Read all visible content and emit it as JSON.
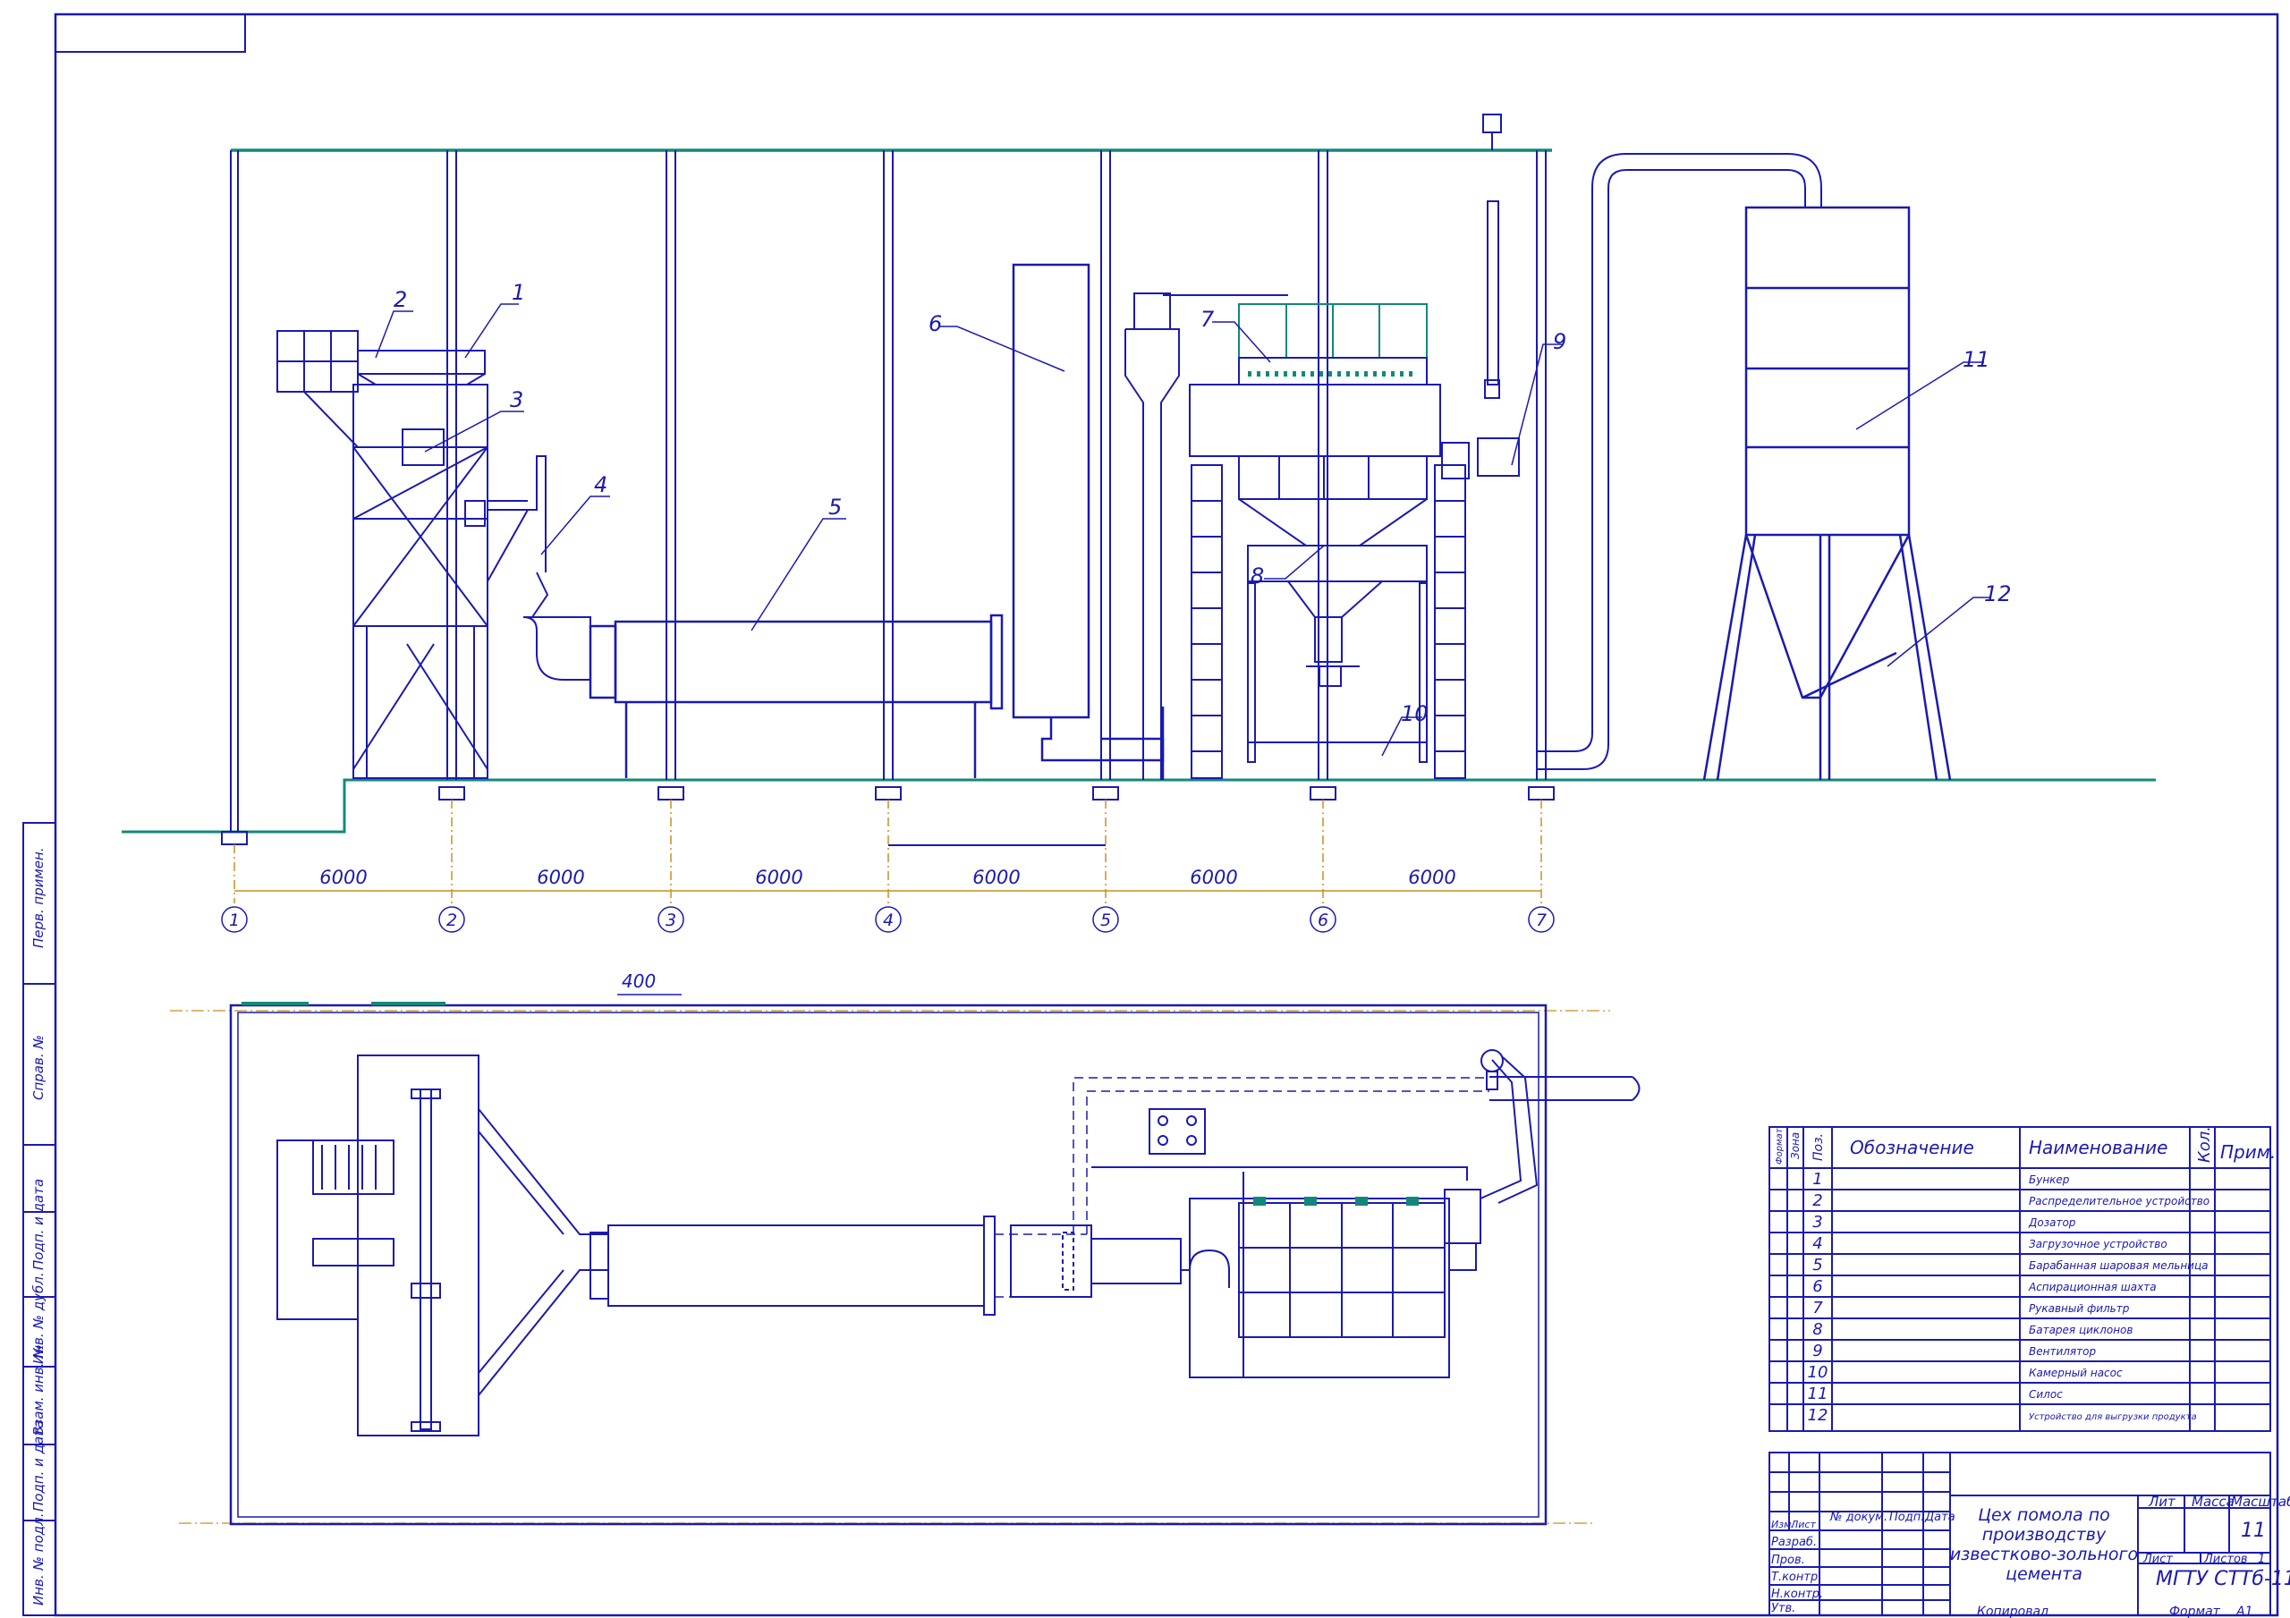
{
  "colors": {
    "line": "#1a1ab0",
    "teal": "#12887a",
    "axis": "#c8901e",
    "bg": "#ffffff"
  },
  "top_view": {
    "spans": [
      "6000",
      "6000",
      "6000",
      "6000",
      "6000",
      "6000"
    ],
    "axes": [
      "1",
      "2",
      "3",
      "4",
      "5",
      "6",
      "7"
    ],
    "callouts": [
      "1",
      "2",
      "3",
      "4",
      "5",
      "6",
      "7",
      "8",
      "9",
      "10",
      "11",
      "12"
    ]
  },
  "plan_view": {
    "dimension": "400"
  },
  "spec_table": {
    "headers": {
      "format": "Формат",
      "zone": "Зона",
      "pos": "Поз.",
      "designation": "Обозначение",
      "name": "Наименование",
      "qty": "Кол.",
      "note": "Прим."
    },
    "rows": [
      {
        "pos": "1",
        "name": "Бункер"
      },
      {
        "pos": "2",
        "name": "Распределительное устройство"
      },
      {
        "pos": "3",
        "name": "Дозатор"
      },
      {
        "pos": "4",
        "name": "Загрузочное устройство"
      },
      {
        "pos": "5",
        "name": "Барабанная шаровая мельница"
      },
      {
        "pos": "6",
        "name": "Аспирационная шахта"
      },
      {
        "pos": "7",
        "name": "Рукавный фильтр"
      },
      {
        "pos": "8",
        "name": "Батарея циклонов"
      },
      {
        "pos": "9",
        "name": "Вентилятор"
      },
      {
        "pos": "10",
        "name": "Камерный насос"
      },
      {
        "pos": "11",
        "name": "Силос"
      },
      {
        "pos": "12",
        "name": "Устройство для выгрузки продукта"
      }
    ]
  },
  "title_block": {
    "title": "Цех помола по производству известково-зольного цемента",
    "org": "МГТУ СТТб-11",
    "sheet_count": "11",
    "col_lit": "Лит",
    "col_mass": "Масса",
    "col_scale": "Масштаб",
    "sheet_label": "Лист",
    "sheets_label": "Листов",
    "sheets_value": "1",
    "head_labels": [
      "Изм.",
      "Лист",
      "№ докум.",
      "Подп.",
      "Дата"
    ],
    "role_labels": [
      "Разраб.",
      "Пров.",
      "Т.контр.",
      "",
      "Н.контр.",
      "Утв."
    ],
    "copied": "Копировал",
    "format_label": "Формат",
    "format_value": "A1"
  },
  "left_stamp": [
    "Перв. примен.",
    "Справ. №",
    "Подп. и дата",
    "Инв. № дубл.",
    "Взам. инв. №",
    "Подп. и дата",
    "Инв. № подл."
  ]
}
